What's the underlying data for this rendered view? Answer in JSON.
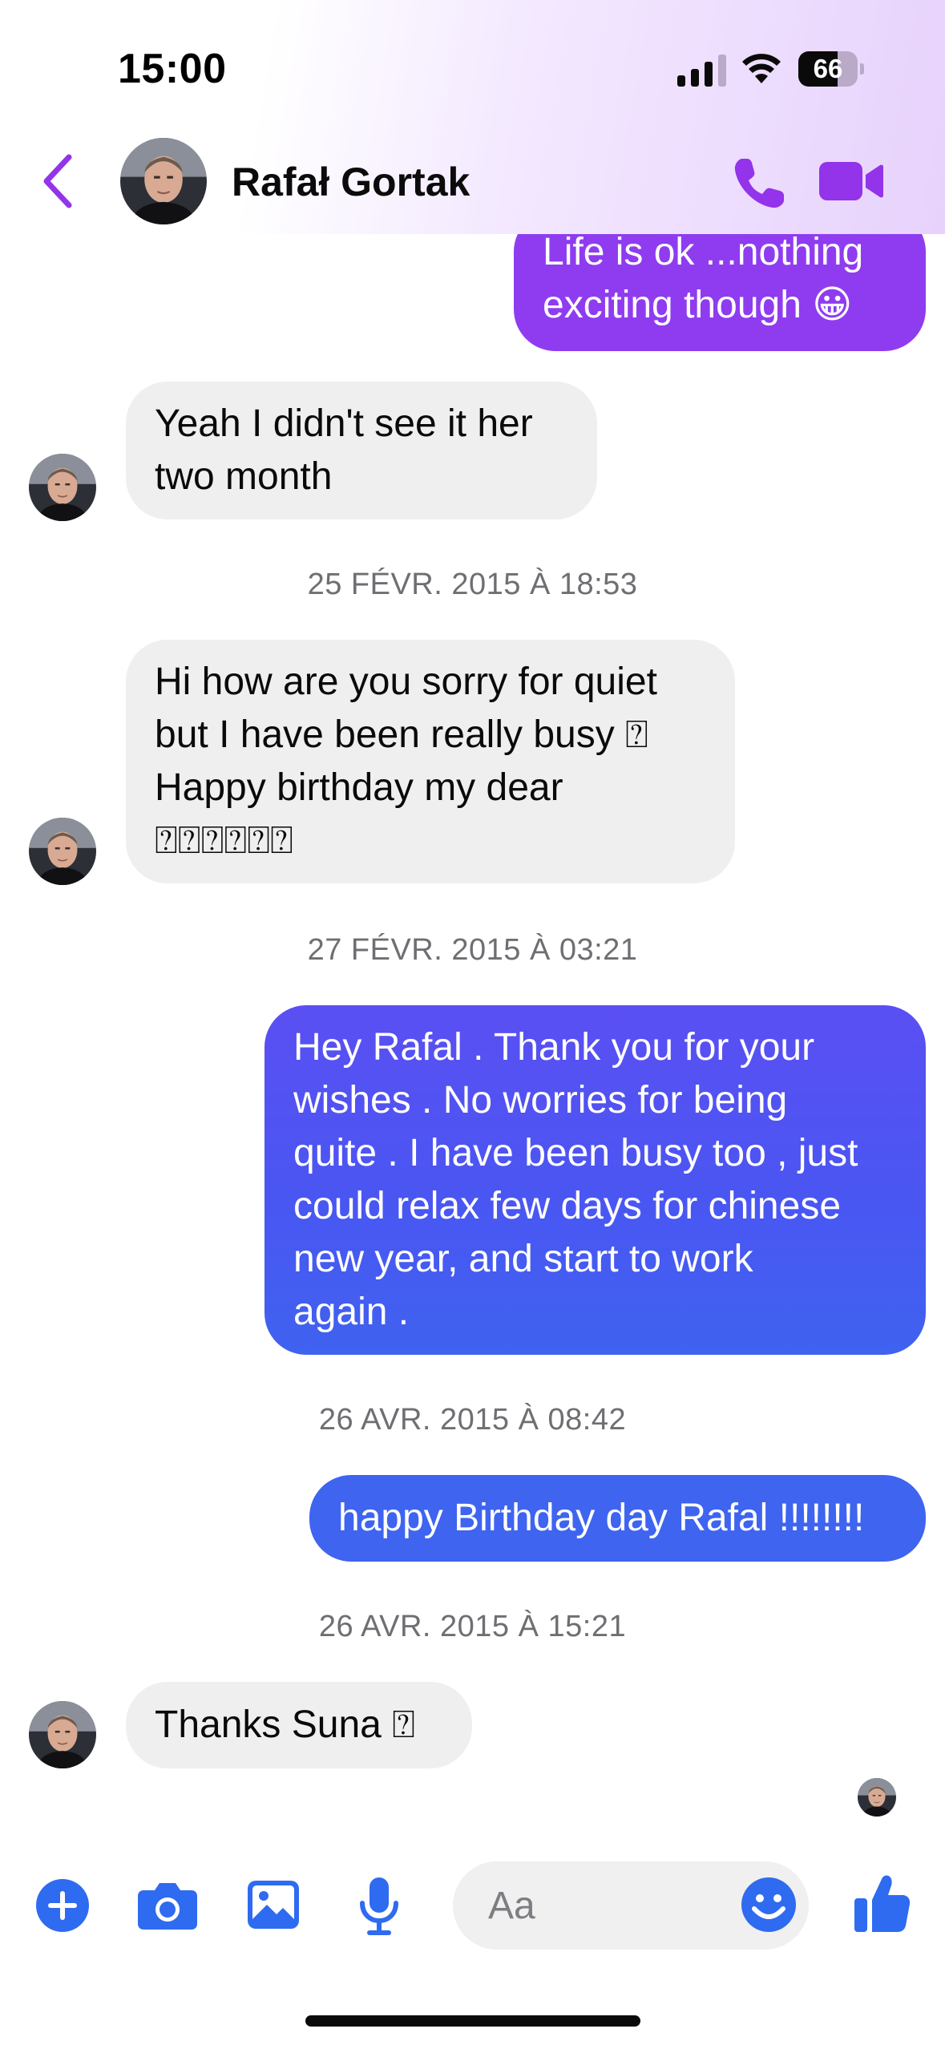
{
  "status_bar": {
    "time": "15:00",
    "battery": "66",
    "battery_level_percent": 66
  },
  "header": {
    "contact_name": "Rafał Gortak"
  },
  "messages": [
    {
      "id": "m1",
      "direction": "out",
      "text": "Life is ok ...nothing\nexciting though 😀"
    },
    {
      "id": "m2",
      "direction": "in",
      "text": "Yeah I didn't see it her\ntwo month"
    },
    {
      "id": "m3",
      "direction": "in",
      "text": "Hi how are you sorry for quiet\nbut I have been really busy ⍰\nHappy birthday my dear\n⍰⍰⍰⍰⍰⍰"
    },
    {
      "id": "m4",
      "direction": "out",
      "text": "Hey Rafal . Thank you for your\nwishes . No worries for being\nquite . I have been busy too , just\ncould relax few days for chinese\nnew year, and start to work\nagain ."
    },
    {
      "id": "m5",
      "direction": "out",
      "text": "happy Birthday day Rafal !!!!!!!!"
    },
    {
      "id": "m6",
      "direction": "in",
      "text": "Thanks Suna ⍰"
    }
  ],
  "timestamps": [
    "25 FÉVR. 2015 À 18:53",
    "27 FÉVR. 2015 À 03:21",
    "26 AVR. 2015 À 08:42",
    "26 AVR. 2015 À 15:21"
  ],
  "composer": {
    "placeholder": "Aa"
  },
  "colors": {
    "accent_purple": "#9333EA",
    "bubble_purple": "#8F3DF0",
    "bubble_indigo": "#4B55F2",
    "bubble_blue": "#3F63F0",
    "toolbar_blue": "#2F6BF0",
    "incoming_bubble": "#EFEFEF"
  },
  "icons": {
    "back": "chevron-left-icon",
    "call": "phone-icon",
    "video": "video-camera-icon",
    "add": "plus-circle-icon",
    "camera": "camera-icon",
    "gallery": "image-icon",
    "mic": "microphone-icon",
    "emoji": "smiley-icon",
    "like": "thumbs-up-icon"
  }
}
